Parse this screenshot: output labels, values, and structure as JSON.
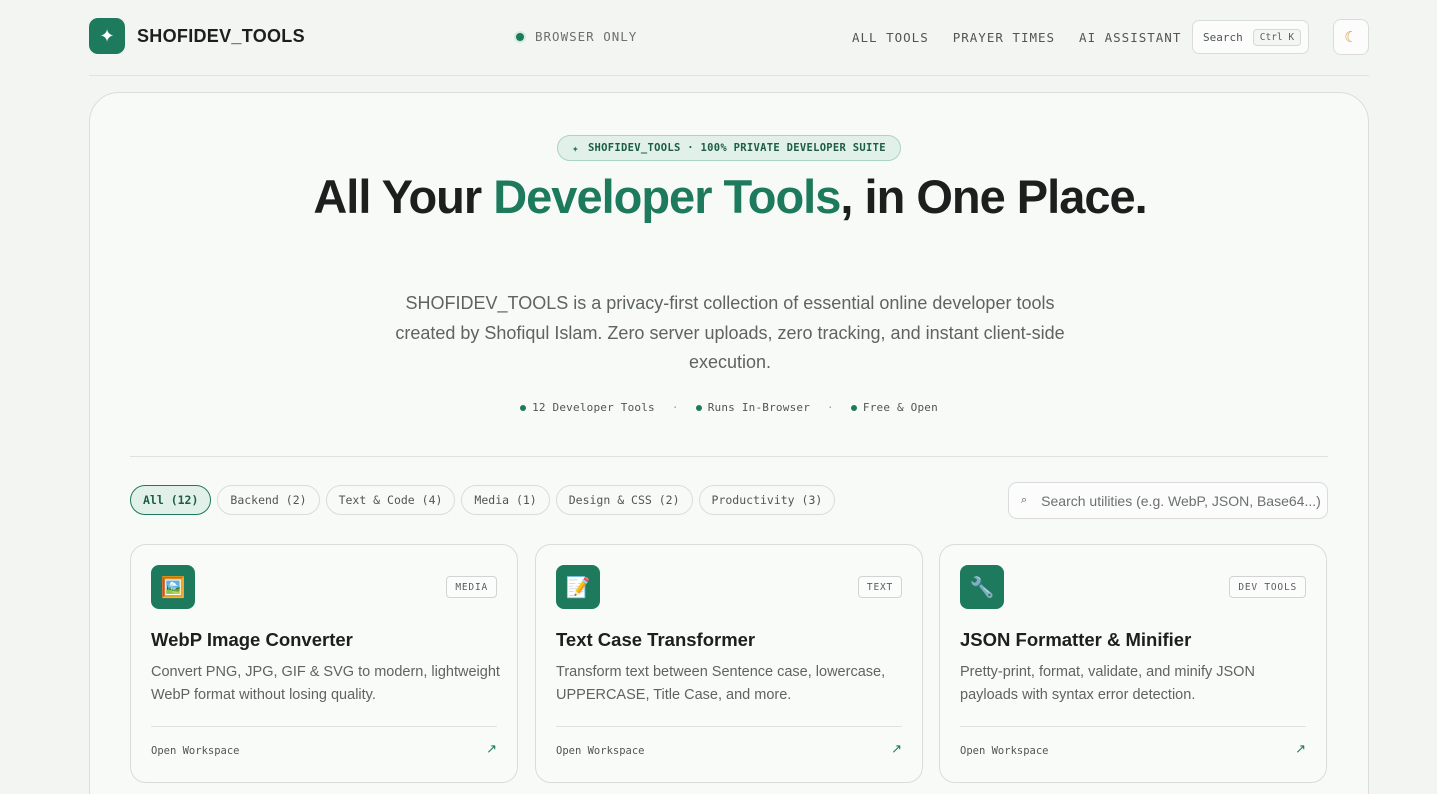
{
  "nav": {
    "brand_icon": "sparkle-icon",
    "brand_name": "SHOFIDEV_TOOLS",
    "status": "BROWSER ONLY",
    "links": [
      "ALL TOOLS",
      "PRAYER TIMES",
      "AI ASSISTANT"
    ],
    "search_label": "Search",
    "search_shortcut": "Ctrl K",
    "theme_icon": "moon-icon"
  },
  "hero": {
    "badge": "SHOFIDEV_TOOLS · 100% PRIVATE DEVELOPER SUITE",
    "title_pre": "All Your ",
    "title_accent": "Developer Tools",
    "title_post": ", in One Place.",
    "description": "SHOFIDEV_TOOLS is a privacy-first collection of essential online developer tools created by Shofiqul Islam. Zero server uploads, zero tracking, and instant client-side execution.",
    "stats": [
      "12 Developer Tools",
      "Runs In-Browser",
      "Free & Open"
    ],
    "stat_separator": "·"
  },
  "filters": {
    "chips": [
      "All (12)",
      "Backend (2)",
      "Text & Code (4)",
      "Media (1)",
      "Design & CSS (2)",
      "Productivity (3)"
    ],
    "active_index": 0,
    "search_placeholder": "Search utilities (e.g. WebP, JSON, Base64...)",
    "search_value": ""
  },
  "cards": [
    {
      "icon": "🖼️",
      "icon_name": "image-icon",
      "tag": "MEDIA",
      "title": "WebP Image Converter",
      "description": "Convert PNG, JPG, GIF & SVG to modern, lightweight WebP format without losing quality.",
      "link": "Open Workspace",
      "arrow": "↗"
    },
    {
      "icon": "📝",
      "icon_name": "document-icon",
      "tag": "TEXT",
      "title": "Text Case Transformer",
      "description": "Transform text between Sentence case, lowercase, UPPERCASE, Title Case, and more.",
      "link": "Open Workspace",
      "arrow": "↗"
    },
    {
      "icon": "🔧",
      "icon_name": "wrench-icon",
      "tag": "DEV TOOLS",
      "title": "JSON Formatter & Minifier",
      "description": "Pretty-print, format, validate, and minify JSON payloads with syntax error detection.",
      "link": "Open Workspace",
      "arrow": "↗"
    }
  ],
  "colors": {
    "accent": "#1d7a5c",
    "background": "#f3f5f3",
    "text": "#1b1f1d"
  }
}
